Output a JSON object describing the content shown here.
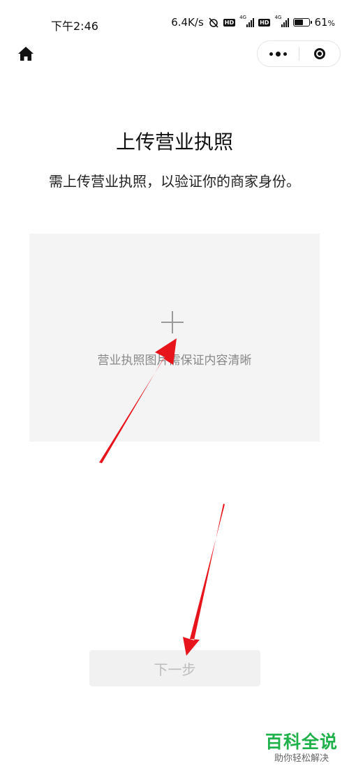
{
  "status_bar": {
    "time": "下午2:46",
    "speed": "6.4K/s",
    "battery_percent": "61",
    "battery_unit": "%",
    "battery_level": 0.61,
    "network_1": "4G",
    "network_2": "4G"
  },
  "page": {
    "title": "上传营业执照",
    "subtitle": "需上传营业执照，以验证你的商家身份。"
  },
  "upload": {
    "hint": "营业执照图片需保证内容清晰"
  },
  "buttons": {
    "next_label": "下一步"
  },
  "watermark": {
    "brand": "百科全说",
    "slogan": "助你轻松解决"
  },
  "colors": {
    "annotation_arrow": "#e8141b",
    "watermark_green": "#21b14b",
    "upload_bg": "#f4f4f4",
    "button_bg": "#f1f1f1"
  },
  "icons": {
    "home": "home-icon",
    "more": "more-dots-icon",
    "close": "target-close-icon",
    "add": "plus-icon"
  }
}
